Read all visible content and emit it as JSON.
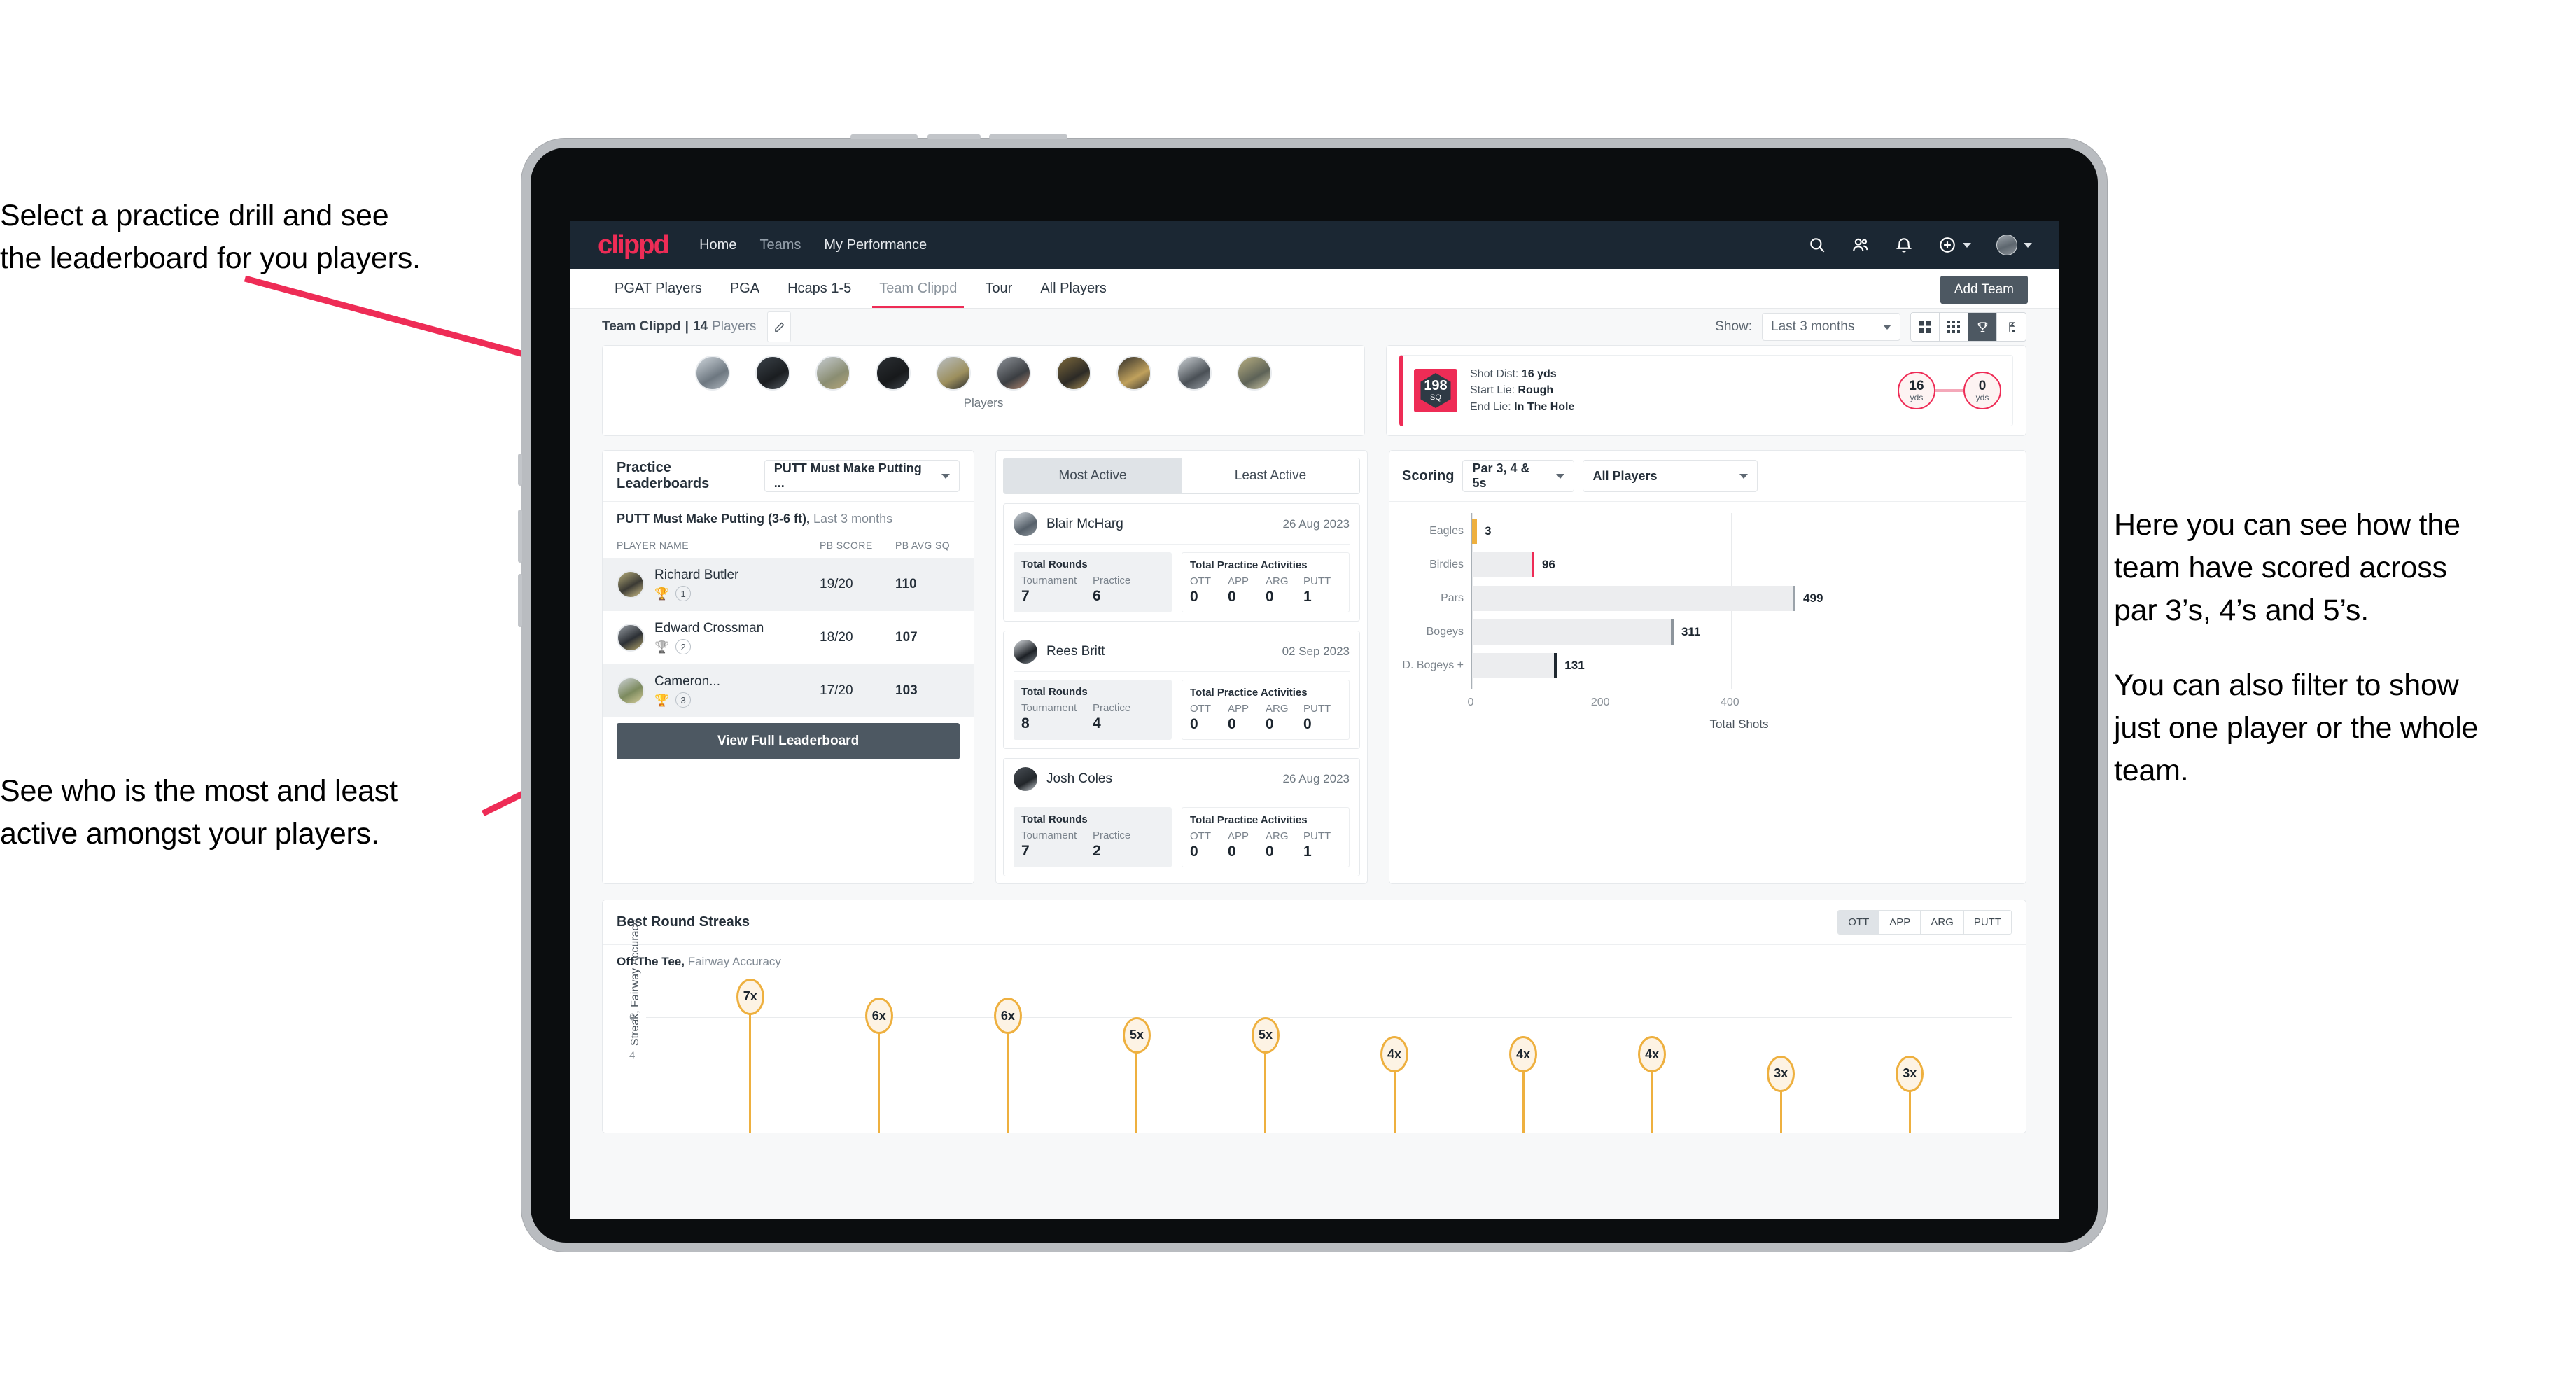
{
  "annotations": {
    "top_left": [
      "Select a practice drill and see",
      "the leaderboard for you players."
    ],
    "bottom_left": [
      "See who is the most and least",
      "active amongst your players."
    ],
    "right_p1": [
      "Here you can see how the",
      "team have scored across",
      "par 3’s, 4’s and 5’s."
    ],
    "right_p2": [
      "You can also filter to show",
      "just one player or the whole",
      "team."
    ]
  },
  "app": {
    "logo": "clippd",
    "nav": [
      {
        "label": "Home",
        "active": true
      },
      {
        "label": "Teams",
        "active": false
      },
      {
        "label": "My Performance",
        "active": true
      }
    ],
    "icons": {
      "search": "search-icon",
      "people": "people-icon",
      "bell": "bell-icon",
      "plus": "plus-circle-icon",
      "avatar": "user-avatar"
    }
  },
  "tabs": [
    {
      "label": "PGAT Players",
      "active": false
    },
    {
      "label": "PGA",
      "active": false
    },
    {
      "label": "Hcaps 1-5",
      "active": false
    },
    {
      "label": "Team Clippd",
      "active": true
    },
    {
      "label": "Tour",
      "active": false
    },
    {
      "label": "All Players",
      "active": false
    }
  ],
  "add_team_label": "Add Team",
  "team_bar": {
    "team_name": "Team Clippd",
    "separator": "|",
    "player_count": "14",
    "players_word": "Players",
    "edit_icon": "pencil-icon",
    "show_label": "Show:",
    "show_value": "Last 3 months",
    "view_buttons": [
      {
        "icon": "grid-4-icon",
        "active": false
      },
      {
        "icon": "grid-9-icon",
        "active": false
      },
      {
        "icon": "trophy-icon",
        "active": true
      },
      {
        "icon": "golf-flag-icon",
        "active": false
      }
    ]
  },
  "players_card": {
    "caption": "Players",
    "avatar_count": 10
  },
  "shot_card": {
    "badge_value": "198",
    "badge_unit": "SQ",
    "lines": [
      {
        "label": "Shot Dist:",
        "value": "16 yds"
      },
      {
        "label": "Start Lie:",
        "value": "Rough"
      },
      {
        "label": "End Lie:",
        "value": "In The Hole"
      }
    ],
    "start_dist": {
      "value": "16",
      "unit": "yds"
    },
    "end_dist": {
      "value": "0",
      "unit": "yds"
    }
  },
  "practice_leaderboard": {
    "title": "Practice Leaderboards",
    "drill_selected": "PUTT Must Make Putting ...",
    "subtitle_bold": "PUTT Must Make Putting (3-6 ft),",
    "subtitle_grey": "Last 3 months",
    "columns": [
      "PLAYER NAME",
      "PB SCORE",
      "PB AVG SQ"
    ],
    "rows": [
      {
        "name": "Richard Butler",
        "rank": "1",
        "trophy": "gold",
        "pb_score": "19/20",
        "pb_avg_sq": "110",
        "highlight": true
      },
      {
        "name": "Edward Crossman",
        "rank": "2",
        "trophy": "silver",
        "pb_score": "18/20",
        "pb_avg_sq": "107",
        "highlight": false
      },
      {
        "name": "Cameron...",
        "rank": "3",
        "trophy": "bronze",
        "pb_score": "17/20",
        "pb_avg_sq": "103",
        "highlight": true
      }
    ],
    "button_label": "View Full Leaderboard"
  },
  "activity": {
    "tabs": [
      {
        "label": "Most Active",
        "active": true
      },
      {
        "label": "Least Active",
        "active": false
      }
    ],
    "rounds_label": "Total Rounds",
    "rounds_cols": [
      "Tournament",
      "Practice"
    ],
    "practice_label": "Total Practice Activities",
    "practice_cols": [
      "OTT",
      "APP",
      "ARG",
      "PUTT"
    ],
    "players": [
      {
        "name": "Blair McHarg",
        "date": "26 Aug 2023",
        "tournament": "7",
        "practice": "6",
        "ott": "0",
        "app": "0",
        "arg": "0",
        "putt": "1"
      },
      {
        "name": "Rees Britt",
        "date": "02 Sep 2023",
        "tournament": "8",
        "practice": "4",
        "ott": "0",
        "app": "0",
        "arg": "0",
        "putt": "0"
      },
      {
        "name": "Josh Coles",
        "date": "26 Aug 2023",
        "tournament": "7",
        "practice": "2",
        "ott": "0",
        "app": "0",
        "arg": "0",
        "putt": "1"
      }
    ]
  },
  "scoring": {
    "title": "Scoring",
    "par_filter": "Par 3, 4 & 5s",
    "player_filter": "All Players"
  },
  "chart_data": {
    "type": "bar",
    "orientation": "horizontal",
    "title": "Scoring",
    "categories": [
      "Eagles",
      "Birdies",
      "Pars",
      "Bogeys",
      "D. Bogeys +"
    ],
    "values": [
      3,
      96,
      499,
      311,
      131
    ],
    "cap_colors": [
      "#eeb03f",
      "#ee2c56",
      "#9ba3aa",
      "#8d959c",
      "#1f2830"
    ],
    "xlabel": "Total Shots",
    "ylabel": "",
    "xticks": [
      0,
      200,
      400
    ],
    "xlim": [
      0,
      540
    ],
    "grid": true,
    "legend": "none"
  },
  "streaks": {
    "title": "Best Round Streaks",
    "seg": [
      {
        "label": "OTT",
        "active": true
      },
      {
        "label": "APP",
        "active": false
      },
      {
        "label": "ARG",
        "active": false
      },
      {
        "label": "PUTT",
        "active": false
      }
    ],
    "sub_bold": "Off The Tee,",
    "sub_grey": "Fairway Accuracy",
    "chart": {
      "type": "bar",
      "ylabel": "Streak, Fairway Accuracy",
      "yticks": [
        4,
        6
      ],
      "ylim": [
        0,
        8
      ],
      "values": [
        7,
        6,
        6,
        5,
        5,
        4,
        4,
        4,
        3,
        3
      ],
      "labels": [
        "7x",
        "6x",
        "6x",
        "5x",
        "5x",
        "4x",
        "4x",
        "4x",
        "3x",
        "3x"
      ]
    }
  }
}
